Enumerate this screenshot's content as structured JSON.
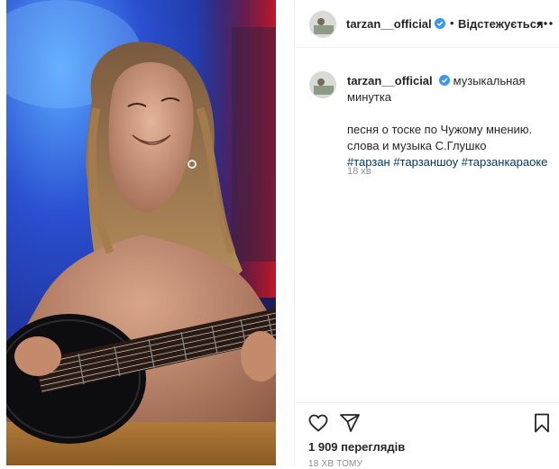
{
  "post": {
    "username": "tarzan__official",
    "follow_label": "Відстежується",
    "dot": "•"
  },
  "caption": {
    "username": "tarzan__official",
    "line1": "музыкальная",
    "line2": "минутка",
    "line3": "песня о тоске по Чужому мнению.",
    "line4": "слова и музыка С.Глушко",
    "hashtags": [
      "#тарзан",
      "#тарзаншоу",
      "#тарзанкараоке"
    ],
    "time": "18 хв"
  },
  "stats": {
    "views": "1 909 переглядів",
    "time_ago": "18 хв тому"
  },
  "icons": {
    "verified": "verified-badge-icon",
    "more": "more-options-icon",
    "like": "heart-icon",
    "share": "paper-plane-icon",
    "save": "bookmark-icon"
  },
  "colors": {
    "verified": "#3897f0",
    "hashtag": "#00376b",
    "muted": "#8e8e8e"
  }
}
